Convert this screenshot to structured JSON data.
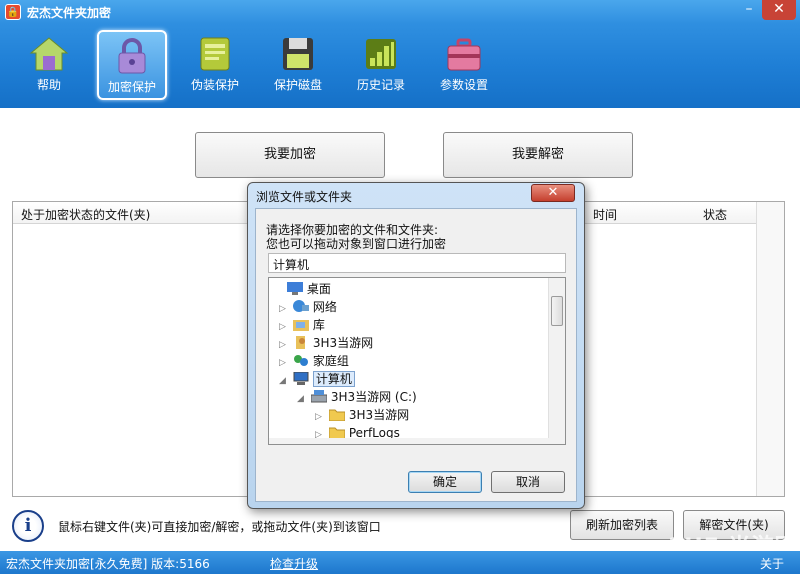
{
  "window": {
    "title": "宏杰文件夹加密",
    "minimize": "–",
    "close": "✕"
  },
  "toolbar": [
    {
      "label": "帮助",
      "icon": "home-icon"
    },
    {
      "label": "加密保护",
      "icon": "lock-icon",
      "active": true
    },
    {
      "label": "伪装保护",
      "icon": "notebook-icon"
    },
    {
      "label": "保护磁盘",
      "icon": "floppy-disk-icon"
    },
    {
      "label": "历史记录",
      "icon": "bar-chart-icon"
    },
    {
      "label": "参数设置",
      "icon": "toolbox-icon"
    }
  ],
  "actions": {
    "encrypt": "我要加密",
    "decrypt": "我要解密"
  },
  "list": {
    "col_file": "处于加密状态的文件(夹)",
    "col_time": "时间",
    "col_status": "状态"
  },
  "hint": "鼠标右键文件(夹)可直接加密/解密，或拖动文件(夹)到该窗口",
  "footer_buttons": {
    "refresh": "刷新加密列表",
    "decrypt_file": "解密文件(夹)"
  },
  "status": {
    "version": "宏杰文件夹加密[永久免费]  版本:5166",
    "check_update": "检查升级",
    "about": "关于"
  },
  "watermark": "3HE 当游网",
  "dialog": {
    "title": "浏览文件或文件夹",
    "close": "✕",
    "prompt_line1": "请选择你要加密的文件和文件夹:",
    "prompt_line2": "您也可以拖动对象到窗口进行加密",
    "selected": "计算机",
    "tree": [
      {
        "label": "桌面",
        "icon": "desktop-icon",
        "arrow": ""
      },
      {
        "label": "网络",
        "icon": "network-icon",
        "arrow": "▷"
      },
      {
        "label": "库",
        "icon": "library-icon",
        "arrow": "▷"
      },
      {
        "label": "3H3当游网",
        "icon": "user-folder-icon",
        "arrow": "▷"
      },
      {
        "label": "家庭组",
        "icon": "homegroup-icon",
        "arrow": "▷"
      },
      {
        "label": "计算机",
        "icon": "computer-icon",
        "arrow": "◢"
      },
      {
        "label": "3H3当游网 (C:)",
        "icon": "drive-icon",
        "arrow": "◢"
      },
      {
        "label": "3H3当游网",
        "icon": "folder-icon",
        "arrow": "▷"
      },
      {
        "label": "PerfLogs",
        "icon": "folder-icon",
        "arrow": "▷"
      }
    ],
    "ok": "确定",
    "cancel": "取消"
  },
  "colors": {
    "accent": "#1f7fd6",
    "status_bar": "#2a86d8"
  }
}
